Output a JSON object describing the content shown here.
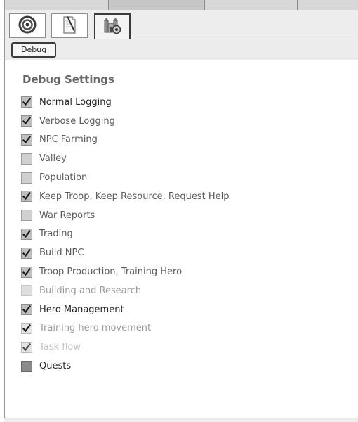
{
  "toolbar": {
    "buttons": [
      {
        "icon": "target-icon",
        "active": false
      },
      {
        "icon": "notepad-icon",
        "active": false
      },
      {
        "icon": "castle-settings-icon",
        "active": true
      }
    ]
  },
  "subtab": {
    "label": "Debug"
  },
  "settings": {
    "title": "Debug Settings",
    "items": [
      {
        "label": "Normal Logging",
        "checked": true,
        "tone": "normal"
      },
      {
        "label": "Verbose Logging",
        "checked": true,
        "tone": "muted"
      },
      {
        "label": "NPC Farming",
        "checked": true,
        "tone": "muted"
      },
      {
        "label": "Valley",
        "checked": false,
        "tone": "muted"
      },
      {
        "label": "Population",
        "checked": false,
        "tone": "muted"
      },
      {
        "label": "Keep Troop, Keep Resource, Request Help",
        "checked": true,
        "tone": "muted"
      },
      {
        "label": "War Reports",
        "checked": false,
        "tone": "muted"
      },
      {
        "label": "Trading",
        "checked": true,
        "tone": "muted"
      },
      {
        "label": "Build NPC",
        "checked": true,
        "tone": "muted"
      },
      {
        "label": "Troop Production, Training Hero",
        "checked": true,
        "tone": "muted"
      },
      {
        "label": "Building and Research",
        "checked": false,
        "tone": "faint"
      },
      {
        "label": "Hero Management",
        "checked": true,
        "tone": "normal"
      },
      {
        "label": "Training hero movement",
        "checked": true,
        "tone": "faint"
      },
      {
        "label": "Task flow",
        "checked": true,
        "tone": "faintest"
      },
      {
        "label": "Quests",
        "checked": false,
        "tone": "normal"
      }
    ]
  }
}
